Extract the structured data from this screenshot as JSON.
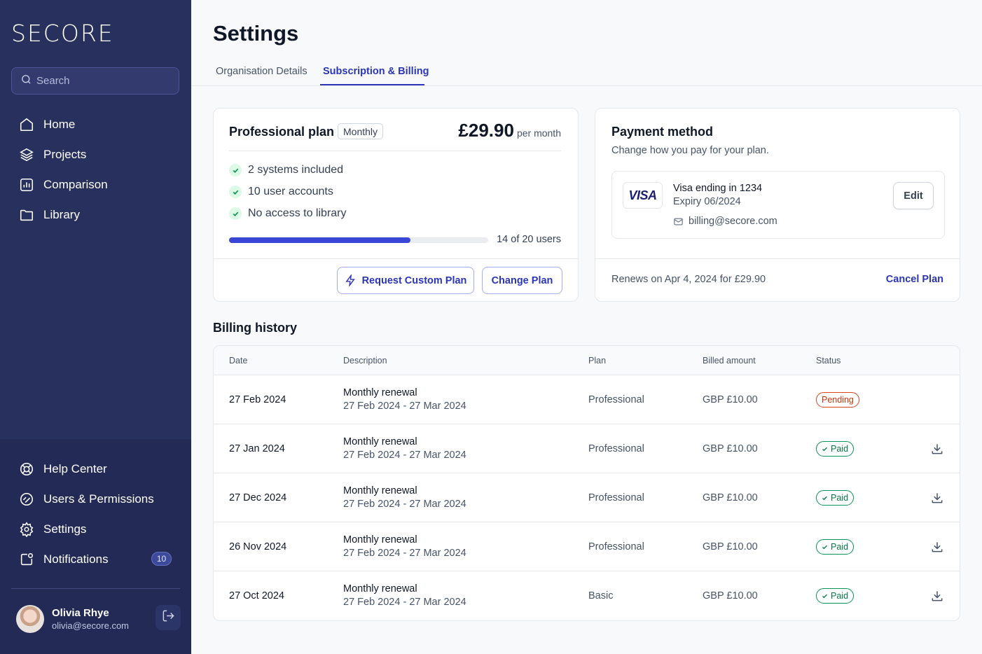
{
  "brand": {
    "logo_text": "SECORE"
  },
  "sidebar": {
    "search_placeholder": "Search",
    "nav": [
      {
        "label": "Home",
        "icon": "home-icon"
      },
      {
        "label": "Projects",
        "icon": "layers-icon"
      },
      {
        "label": "Comparison",
        "icon": "bar-chart-icon"
      },
      {
        "label": "Library",
        "icon": "folder-icon"
      }
    ],
    "bottom_nav": [
      {
        "label": "Help Center",
        "icon": "life-buoy-icon"
      },
      {
        "label": "Users & Permissions",
        "icon": "users-permissions-icon"
      },
      {
        "label": "Settings",
        "icon": "gear-icon"
      },
      {
        "label": "Notifications",
        "icon": "notification-icon",
        "badge": "10"
      }
    ],
    "user": {
      "name": "Olivia Rhye",
      "email": "olivia@secore.com"
    }
  },
  "page": {
    "title": "Settings",
    "tabs": [
      {
        "label": "Organisation Details",
        "active": false
      },
      {
        "label": "Subscription & Billing",
        "active": true
      }
    ]
  },
  "plan": {
    "name": "Professional plan",
    "cycle": "Monthly",
    "price": "£29.90",
    "price_unit": "per month",
    "features": [
      "2 systems included",
      "10 user accounts",
      "No access to library"
    ],
    "usage_text": "14 of 20 users",
    "usage_fraction": 0.7,
    "request_custom_label": "Request Custom Plan",
    "change_plan_label": "Change Plan"
  },
  "payment": {
    "title": "Payment method",
    "subtitle": "Change how you pay for your plan.",
    "card_brand": "VISA",
    "card_line": "Visa ending in 1234",
    "expiry": "Expiry 06/2024",
    "email": "billing@secore.com",
    "edit_label": "Edit",
    "renew_text": "Renews on Apr 4, 2024 for £29.90",
    "cancel_label": "Cancel Plan"
  },
  "billing": {
    "title": "Billing history",
    "columns": [
      "Date",
      "Description",
      "Plan",
      "Billed amount",
      "Status"
    ],
    "rows": [
      {
        "date": "27 Feb 2024",
        "desc": "Monthly renewal",
        "period": "27 Feb 2024 - 27 Mar 2024",
        "plan": "Professional",
        "amount": "GBP £10.00",
        "status": "Pending",
        "download": false
      },
      {
        "date": "27 Jan 2024",
        "desc": "Monthly renewal",
        "period": "27 Feb 2024 - 27 Mar 2024",
        "plan": "Professional",
        "amount": "GBP £10.00",
        "status": "Paid",
        "download": true
      },
      {
        "date": "27 Dec 2024",
        "desc": "Monthly renewal",
        "period": "27 Feb 2024 - 27 Mar 2024",
        "plan": "Professional",
        "amount": "GBP £10.00",
        "status": "Paid",
        "download": true
      },
      {
        "date": "26 Nov 2024",
        "desc": "Monthly renewal",
        "period": "27 Feb 2024 - 27 Mar 2024",
        "plan": "Professional",
        "amount": "GBP £10.00",
        "status": "Paid",
        "download": true
      },
      {
        "date": "27 Oct 2024",
        "desc": "Monthly renewal",
        "period": "27 Feb 2024 - 27 Mar 2024",
        "plan": "Basic",
        "amount": "GBP £10.00",
        "status": "Paid",
        "download": true
      }
    ]
  },
  "colors": {
    "sidebar": "#28305e",
    "accent": "#2b35b5",
    "progress": "#3a47d6",
    "paid": "#067647",
    "pending": "#c4320a"
  }
}
